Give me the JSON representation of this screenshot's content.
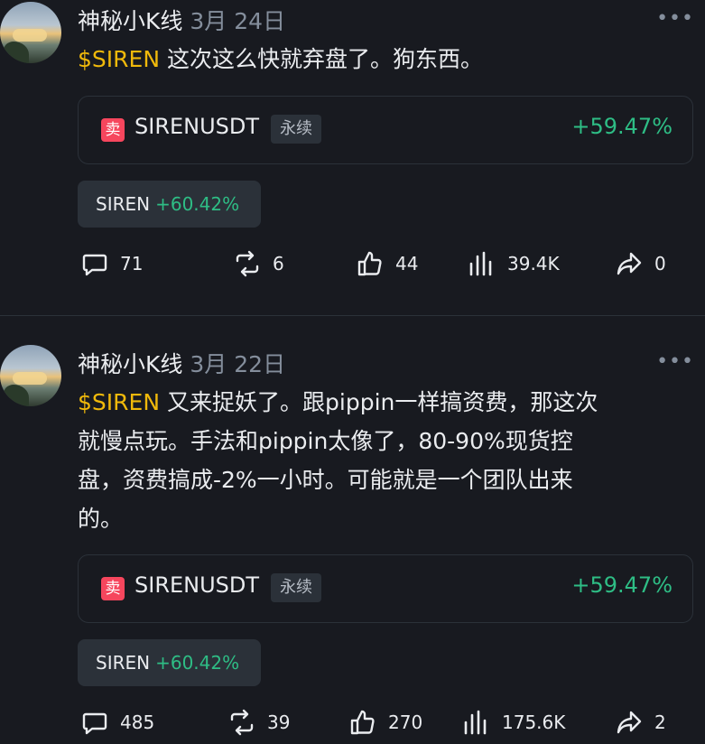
{
  "posts": [
    {
      "author": "神秘小K线",
      "date": "3月 24日",
      "more": "•••",
      "ticker": "$SIREN",
      "lines": [
        "这次这么快就弃盘了。狗东西。"
      ],
      "card": {
        "side": "卖",
        "symbol": "SIRENUSDT",
        "tag": "永续",
        "change": "+59.47%"
      },
      "chip": {
        "name": "SIREN",
        "change": "+60.42%"
      },
      "stats": {
        "comments": "71",
        "reposts": "6",
        "likes": "44",
        "views": "39.4K",
        "shares": "0"
      }
    },
    {
      "author": "神秘小K线",
      "date": "3月 22日",
      "more": "•••",
      "ticker": "$SIREN",
      "lines": [
        "又来捉妖了。跟pippin一样搞资费，那这次",
        "就慢点玩。手法和pippin太像了，80-90%现货控",
        "盘，资费搞成-2%一小时。可能就是一个团队出来",
        "的。"
      ],
      "card": {
        "side": "卖",
        "symbol": "SIRENUSDT",
        "tag": "永续",
        "change": "+59.47%"
      },
      "chip": {
        "name": "SIREN",
        "change": "+60.42%"
      },
      "stats": {
        "comments": "485",
        "reposts": "39",
        "likes": "270",
        "views": "175.6K",
        "shares": "2"
      }
    }
  ],
  "icons": {
    "comment": "comment-icon",
    "repost": "repost-icon",
    "like": "like-icon",
    "views": "views-icon",
    "share": "share-icon"
  },
  "colors": {
    "background": "#181a20",
    "ticker": "#f0b90b",
    "positive": "#2ebd85",
    "sell": "#f6465d",
    "muted": "#848e9c"
  }
}
